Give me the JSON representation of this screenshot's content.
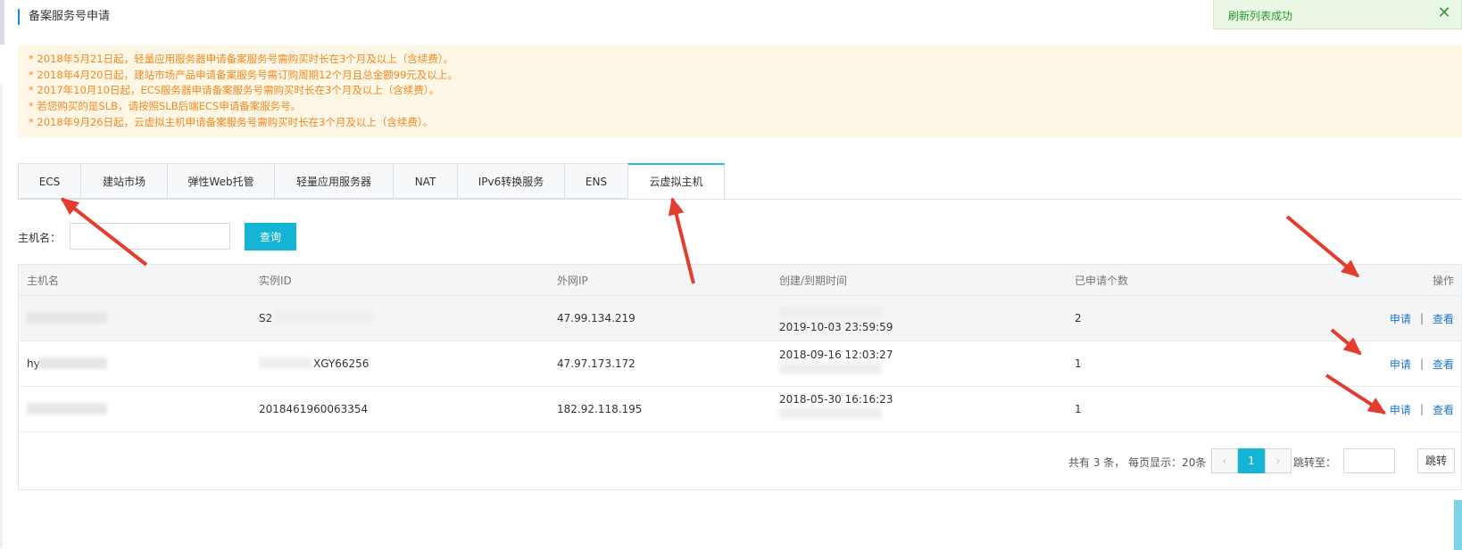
{
  "page": {
    "title": "备案服务号申请"
  },
  "toast": {
    "message": "刷新列表成功",
    "close_icon": "✕"
  },
  "notices": [
    "* 2018年5月21日起，轻量应用服务器申请备案服务号需购买时长在3个月及以上（含续费）。",
    "* 2018年4月20日起，建站市场产品申请备案服务号需订购周期12个月且总金额99元及以上。",
    "* 2017年10月10日起，ECS服务器申请备案服务号需购买时长在3个月及以上（含续费）。",
    "* 若您购买的是SLB，请按照SLB后端ECS申请备案服务号。",
    "* 2018年9月26日起，云虚拟主机申请备案服务号需购买时长在3个月及以上（含续费）。"
  ],
  "tabs": [
    {
      "label": "ECS"
    },
    {
      "label": "建站市场"
    },
    {
      "label": "弹性Web托管"
    },
    {
      "label": "轻量应用服务器"
    },
    {
      "label": "NAT"
    },
    {
      "label": "IPv6转换服务"
    },
    {
      "label": "ENS"
    },
    {
      "label": "云虚拟主机",
      "active": true
    }
  ],
  "search": {
    "label": "主机名：",
    "value": "",
    "button": "查询"
  },
  "table": {
    "headers": [
      "主机名",
      "实例ID",
      "外网IP",
      "创建/到期时间",
      "已申请个数",
      "操作"
    ],
    "rows": [
      {
        "host": "",
        "instance": "S2",
        "ip": "47.99.134.219",
        "time": "2019-10-03 23:59:59",
        "count": "2"
      },
      {
        "host": "hy",
        "instance": "XGY66256",
        "ip": "47.97.173.172",
        "time": "2018-09-16 12:03:27",
        "count": "1"
      },
      {
        "host": "",
        "instance": "2018461960063354",
        "ip": "182.92.118.195",
        "time": "2018-05-30 16:16:23",
        "count": "1"
      }
    ],
    "actions": {
      "apply": "申请",
      "sep": "|",
      "view": "查看"
    }
  },
  "pager": {
    "info": "共有 3 条， 每页显示：20条",
    "prev": "‹",
    "current": "1",
    "next": "›",
    "jump_label": "跳转至：",
    "jump_button": "跳转"
  },
  "colors": {
    "accent": "#13b4d4",
    "notice_text": "#f08a24",
    "link": "#1a77c9",
    "annotation": "#e53c30"
  }
}
